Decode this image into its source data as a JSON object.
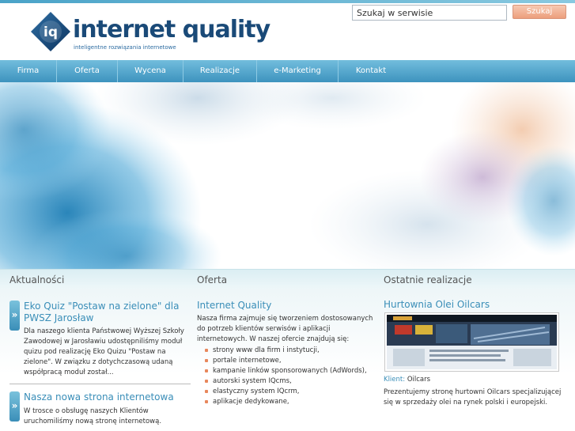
{
  "brand": {
    "name": "internet quality",
    "monogram": "iq",
    "tagline": "inteligentne rozwiązania internetowe"
  },
  "search": {
    "placeholder": "Szukaj w serwisie",
    "button_label": "Szukaj"
  },
  "nav": {
    "items": [
      {
        "label": "Firma"
      },
      {
        "label": "Oferta"
      },
      {
        "label": "Wycena"
      },
      {
        "label": "Realizacje"
      },
      {
        "label": "e-Marketing"
      },
      {
        "label": "Kontakt"
      }
    ]
  },
  "sections": {
    "news_heading": "Aktualności",
    "offer_heading": "Oferta",
    "projects_heading": "Ostatnie realizacje"
  },
  "news": [
    {
      "arrow": "»",
      "title": "Eko Quiz \"Postaw na zielone\" dla PWSZ Jarosław",
      "text": "Dla naszego klienta Państwowej Wyższej Szkoły Zawodowej w Jarosławiu udostępniliśmy moduł quizu pod realizację Eko Quizu \"Postaw na zielone\". W związku z dotychczasową udaną współpracą moduł został..."
    },
    {
      "arrow": "»",
      "title": "Nasza nowa strona internetowa",
      "text": "W trosce o obsługę naszych Klientów uruchomiliśmy nową stronę internetową."
    }
  ],
  "offer": {
    "title": "Internet Quality",
    "intro": "Nasza firma zajmuje się tworzeniem dostosowanych do potrzeb klientów serwisów i aplikacji internetowych. W naszej ofercie znajdują się:",
    "items": [
      "strony www dla firm i instytucji,",
      "portale internetowe,",
      "kampanie linków sponsorowanych (AdWords),",
      "autorski system IQcms,",
      "elastyczny system IQcrm,",
      "aplikacje dedykowane,"
    ]
  },
  "project": {
    "title": "Hurtownia Olei Oilcars",
    "client_label": "Klient:",
    "client_name": "Oilcars",
    "description": "Prezentujemy stronę hurtowni Oilcars specjalizującej się w sprzedaży olei na rynek polski i europejski."
  },
  "colors": {
    "accent_blue": "#3a8eb8",
    "nav_gradient_top": "#72bddd",
    "nav_gradient_bottom": "#3d93be",
    "search_button": "#ec9e7c",
    "bullet": "#e8875c",
    "logo_navy": "#1a4a78"
  }
}
